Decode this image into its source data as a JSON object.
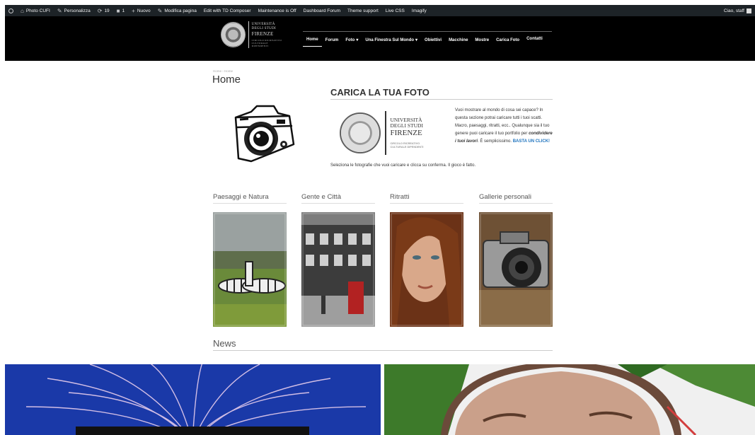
{
  "adminbar": {
    "site": "Photo CUFI",
    "customize": "Personalizza",
    "updates": "19",
    "comments": "1",
    "new": "Nuovo",
    "edit_page": "Modifica pagina",
    "td_composer": "Edit with TD Composer",
    "maintenance": "Maintenance is Off",
    "dashboard_forum": "Dashboard Forum",
    "theme_support": "Theme support",
    "live_css": "Live CSS",
    "imagify": "Imagify",
    "greeting": "Ciao, staff"
  },
  "logo": {
    "line1": "UNIVERSITÀ",
    "line2": "DEGLI STUDI",
    "line3": "FIRENZE",
    "line4": "CIRCOLO RICREATIVO",
    "line5": "CULTURALE DIPENDENTI"
  },
  "nav": {
    "home": "Home",
    "forum": "Forum",
    "foto": "Foto",
    "finestra": "Una Finestra Sul Mondo",
    "obiettivi": "Obiettivi",
    "macchine": "Macchine",
    "mostre": "Mostre",
    "carica": "Carica Foto",
    "contatti": "Contatti"
  },
  "breadcrumb": "Home › Home",
  "page_title": "Home",
  "upload": {
    "title": "CARICA LA TUA FOTO",
    "unifi_line1": "UNIVERSITÀ",
    "unifi_line2": "DEGLI STUDI",
    "unifi_line3": "FIRENZE",
    "unifi_line4": "CIRCOLO RICREATIVO",
    "unifi_line5": "CULTURALE DIPENDENTI",
    "desc_a": "Vuoi mostrare al mondo di cosa sei capace? In questa sezione potrai caricare tutti i tuoi scatti. Macro, paesaggi, ritratti, ecc.. Qualunque sia il tuo genere puoi caricare il tuo portfolio per ",
    "desc_bold": "condividere i tuoi lavori",
    "desc_b": ". È semplicissimo. ",
    "desc_cta": "BASTA UN CLICK!",
    "desc2": "Seleziona le fotografie che vuoi caricare e clicca su conferma. Il gioco è fatto."
  },
  "categories": [
    {
      "title": "Paesaggi e Natura"
    },
    {
      "title": "Gente e Città"
    },
    {
      "title": "Ritratti"
    },
    {
      "title": "Gallerie personali"
    }
  ],
  "news_title": "News"
}
